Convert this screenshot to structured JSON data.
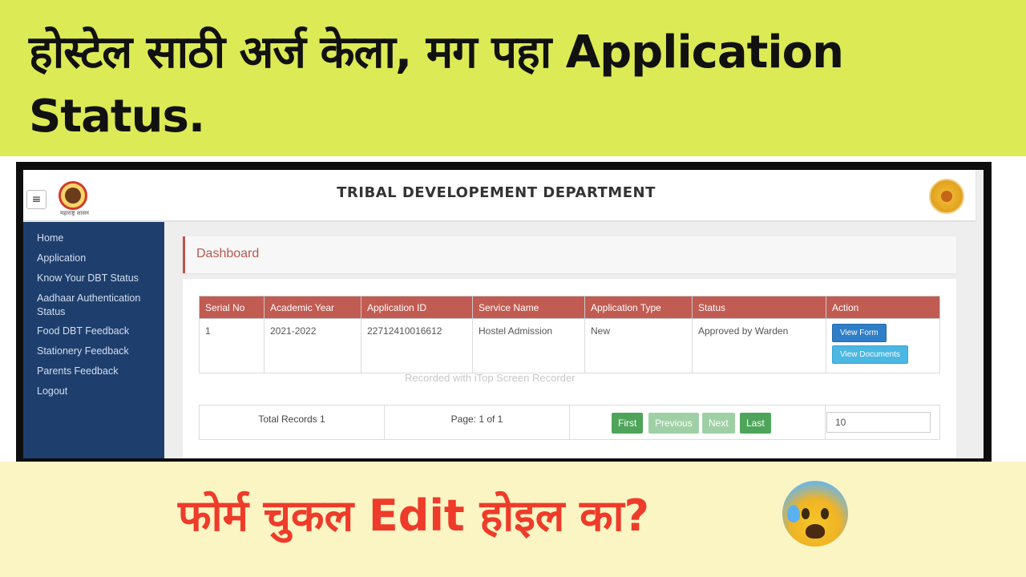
{
  "top_caption": "होस्टेल साठी अर्ज केला, मग पहा Application Status.",
  "bottom_caption": "फोर्म चुकल Edit होइल का?",
  "emoji": "anxious-face-with-sweat-icon",
  "app": {
    "title": "TRIBAL DEVELOPEMENT DEPARTMENT",
    "logo_caption": "महाराष्ट्र शासन"
  },
  "sidebar": {
    "items": [
      {
        "label": "Home"
      },
      {
        "label": "Application"
      },
      {
        "label": "Know Your DBT Status"
      },
      {
        "label": "Aadhaar Authentication Status"
      },
      {
        "label": "Food DBT Feedback"
      },
      {
        "label": "Stationery Feedback"
      },
      {
        "label": "Parents Feedback"
      },
      {
        "label": "Logout"
      }
    ]
  },
  "dashboard": {
    "title": "Dashboard",
    "table": {
      "headers": [
        "Serial No",
        "Academic Year",
        "Application ID",
        "Service Name",
        "Application Type",
        "Status",
        "Action"
      ],
      "rows": [
        {
          "serial": "1",
          "academic_year": "2021-2022",
          "application_id": "22712410016612",
          "service_name": "Hostel Admission",
          "application_type": "New",
          "status": "Approved by Warden",
          "actions": [
            "View Form",
            "View Documents"
          ]
        }
      ]
    },
    "watermark": "Recorded with iTop Screen Recorder",
    "pager": {
      "total_records": "Total Records 1",
      "page_info": "Page: 1 of 1",
      "first": "First",
      "previous": "Previous",
      "next": "Next",
      "last": "Last",
      "page_size": "10"
    }
  },
  "colors": {
    "top_banner": "#dcea55",
    "bottom_banner": "#fbf5c4",
    "bottom_caption": "#ee3b2a",
    "sidebar": "#1e3f6d",
    "table_header": "#c25b52",
    "pager_active": "#4ea55a",
    "pager_disabled": "#9fd0a5"
  }
}
